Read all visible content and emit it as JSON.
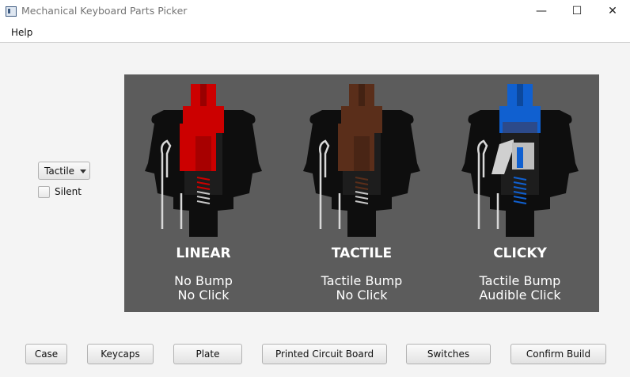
{
  "window": {
    "title": "Mechanical Keyboard Parts Picker",
    "icon": "app-icon"
  },
  "menu": {
    "help": "Help"
  },
  "controls": {
    "switch_type_selected": "Tactile",
    "silent_label": "Silent",
    "silent_checked": false
  },
  "switch_image": {
    "types": [
      {
        "name": "LINEAR",
        "line1": "No Bump",
        "line2": "No Click",
        "stem_color": "#cc0000"
      },
      {
        "name": "TACTILE",
        "line1": "Tactile Bump",
        "line2": "No Click",
        "stem_color": "#5a2e1a"
      },
      {
        "name": "CLICKY",
        "line1": "Tactile Bump",
        "line2": "Audible Click",
        "stem_color": "#1060d0"
      }
    ]
  },
  "buttons": {
    "case": "Case",
    "keycaps": "Keycaps",
    "plate": "Plate",
    "pcb": "Printed Circuit Board",
    "switches": "Switches",
    "confirm": "Confirm Build"
  }
}
